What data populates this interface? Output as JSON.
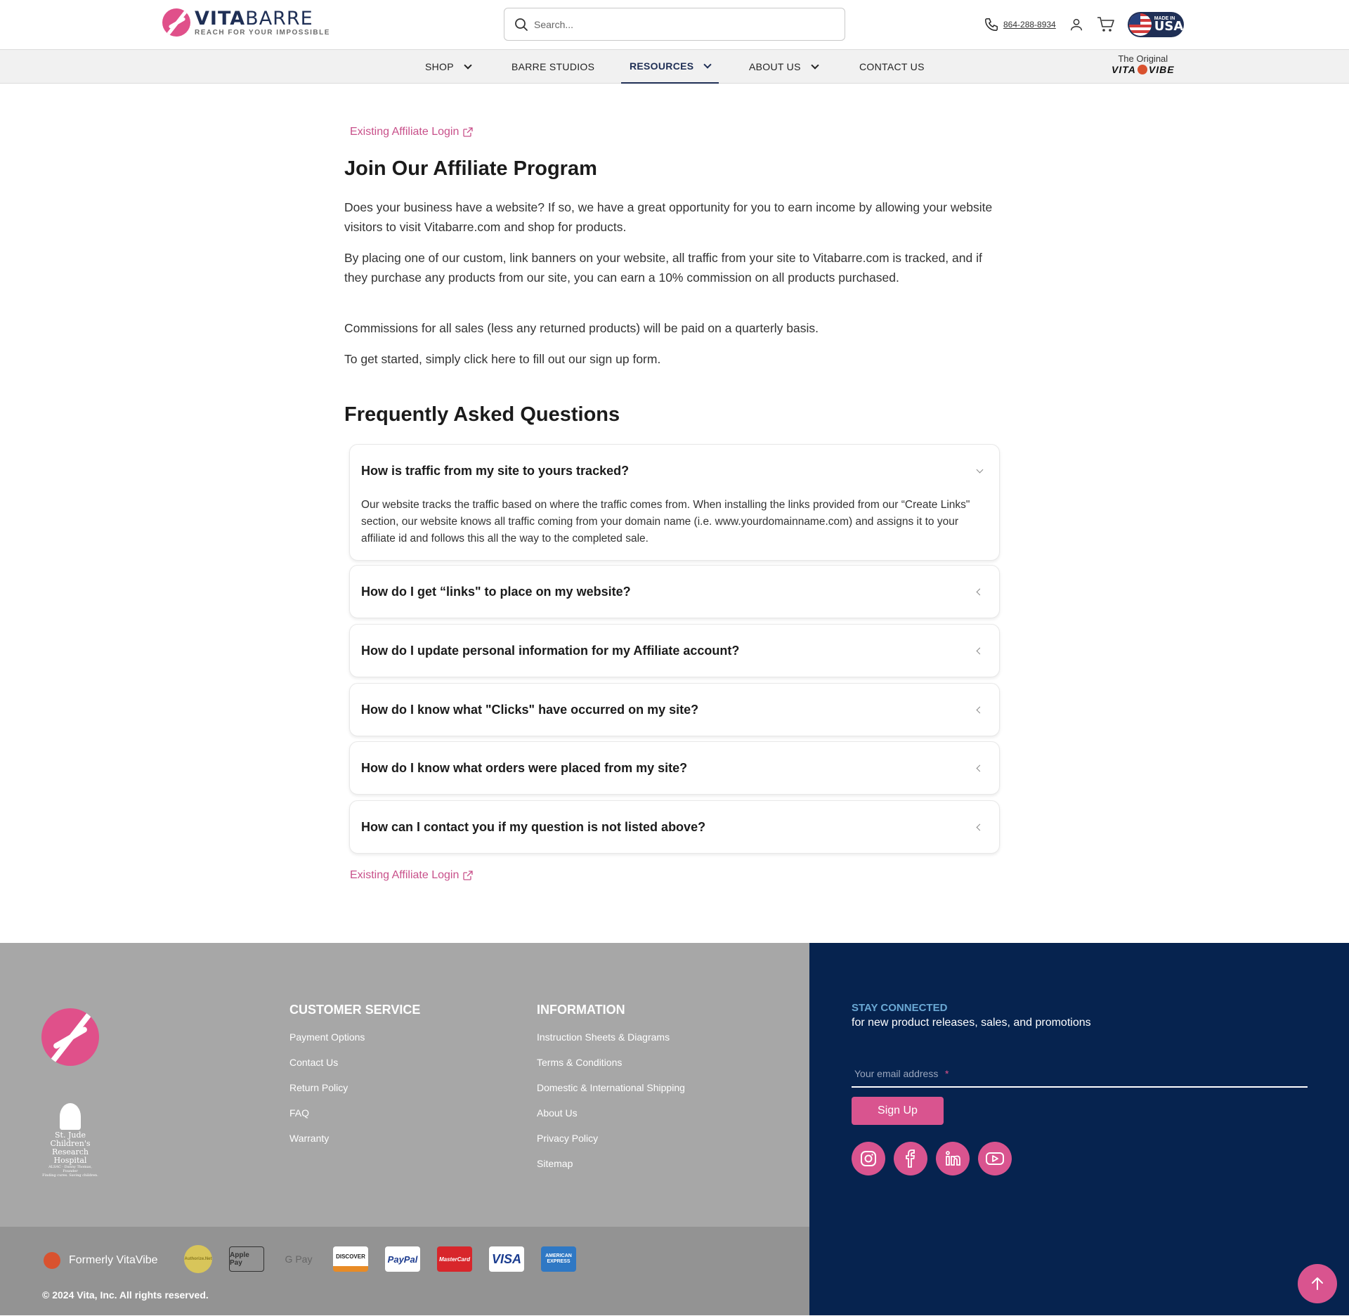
{
  "header": {
    "logo_name_a": "VITA",
    "logo_name_b": "BARRE",
    "logo_tagline": "REACH FOR YOUR IMPOSSIBLE",
    "search_placeholder": "Search...",
    "phone": "864-288-8934",
    "usa_badge_small": "MADE IN",
    "usa_badge_big": "USA"
  },
  "nav": {
    "items": [
      {
        "label": "SHOP",
        "has_dropdown": true
      },
      {
        "label": "BARRE STUDIOS",
        "has_dropdown": false
      },
      {
        "label": "RESOURCES",
        "has_dropdown": true,
        "active": true
      },
      {
        "label": "ABOUT US",
        "has_dropdown": true
      },
      {
        "label": "CONTACT US",
        "has_dropdown": false
      }
    ],
    "original_label": "The Original",
    "original_brand_a": "VITA",
    "original_brand_b": "VIBE"
  },
  "main": {
    "login_link": "Existing Affiliate Login",
    "title": "Join Our Affiliate Program",
    "paragraphs": [
      "Does your business have a website? If so, we have a great opportunity for you to earn income by allowing your website visitors to visit Vitabarre.com and shop for products.",
      "By placing one of our custom, link banners on your website, all traffic from your site to Vitabarre.com is tracked, and if they purchase any products from our site, you can earn a 10% commission on all products purchased.",
      "Commissions for all sales (less any returned products) will be paid on a quarterly basis.",
      "To get started, simply click here to fill out our sign up form."
    ],
    "faq_title": "Frequently Asked Questions",
    "faq": [
      {
        "q": "How is traffic from my site to yours tracked?",
        "expanded": true,
        "a": "Our website tracks the traffic based on where the traffic comes from. When installing the links provided from our “Create Links\" section, our website knows all traffic coming from your domain name (i.e. www.yourdomainname.com) and assigns it to your affiliate id and follows this all the way to the completed sale."
      },
      {
        "q": "How do I get “links\" to place on my website?",
        "expanded": false
      },
      {
        "q": "How do I update personal information for my Affiliate account?",
        "expanded": false
      },
      {
        "q": "How do I know what \"Clicks\" have occurred on my site?",
        "expanded": false
      },
      {
        "q": "How do I know what orders were placed from my site?",
        "expanded": false
      },
      {
        "q": "How can I contact you if my question is not listed above?",
        "expanded": false
      }
    ]
  },
  "footer": {
    "stjude_line1": "St. Jude Children's",
    "stjude_line2": "Research Hospital",
    "stjude_line3": "ALSAC · Danny Thomas, Founder",
    "stjude_line4": "Finding cures. Saving children.",
    "customer_service_title": "CUSTOMER SERVICE",
    "customer_service_links": [
      "Payment Options",
      "Contact Us",
      "Return Policy",
      "FAQ",
      "Warranty"
    ],
    "information_title": "INFORMATION",
    "information_links": [
      "Instruction Sheets & Diagrams",
      "Terms & Conditions",
      "Domestic & International Shipping",
      "About Us",
      "Privacy Policy",
      "Sitemap"
    ],
    "formerly": "Formerly VitaVibe",
    "payments": [
      "Authorize.Net",
      "Apple Pay",
      "G Pay",
      "DISCOVER",
      "PayPal",
      "MasterCard",
      "VISA",
      "AMERICAN EXPRESS"
    ],
    "copyright": "© 2024 Vita, Inc. All rights reserved.",
    "stay_title": "STAY CONNECTED",
    "stay_sub": "for new product releases, sales, and promotions",
    "email_placeholder": "Your email address",
    "email_required_mark": "*",
    "signup_label": "Sign Up",
    "socials": [
      "instagram-icon",
      "facebook-icon",
      "linkedin-icon",
      "youtube-icon"
    ]
  },
  "colors": {
    "brand_pink": "#d9548f",
    "navy": "#06234f",
    "footer_gray": "#a7a7a7"
  }
}
